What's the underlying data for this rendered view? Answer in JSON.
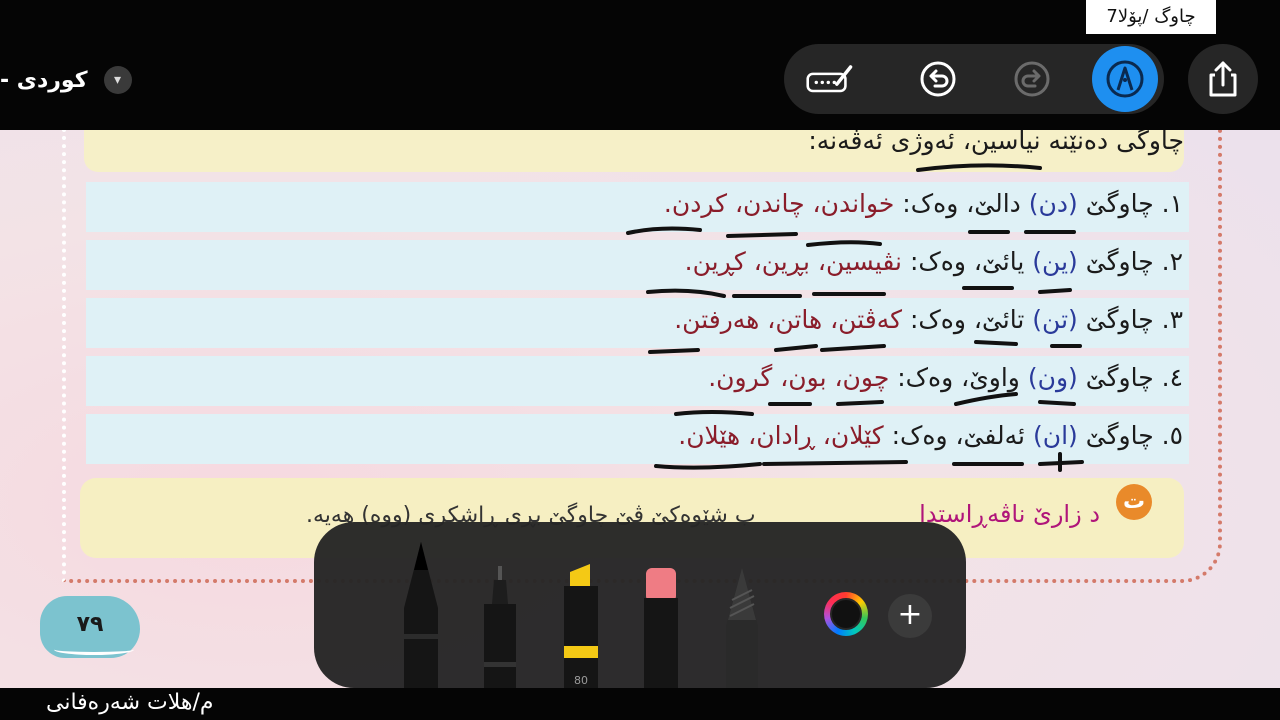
{
  "window": {
    "title": "چاوگ /پۆلا7"
  },
  "language": {
    "label": "کوردی -"
  },
  "toolbar": {
    "markup_icon": "markup-icon",
    "undo_icon": "undo-icon",
    "redo_icon": "redo-icon",
    "pen_icon": "pen-active-icon",
    "share_icon": "share-icon"
  },
  "content": {
    "intro": "چاوگی دەنێنە نیاسین، ئەوژی ئەڤەنە:",
    "rules": [
      {
        "number": "١.",
        "prefix": "چاوگێ",
        "suffix": "دن",
        "letter": "دالێ، وەک:",
        "examples": "خواندن، چاندن، کردن."
      },
      {
        "number": "٢.",
        "prefix": "چاوگێ",
        "suffix": "ین",
        "letter": "یائێ، وەک:",
        "examples": "نڤیسین، بڕین، کڕین."
      },
      {
        "number": "٣.",
        "prefix": "چاوگێ",
        "suffix": "تن",
        "letter": "تائێ، وەک:",
        "examples": "کەڤتن، هاتن، هەرفتن."
      },
      {
        "number": "٤.",
        "prefix": "چاوگێ",
        "suffix": "ون",
        "letter": "واوێ، وەک:",
        "examples": "چون، بون، گرون."
      },
      {
        "number": "٥.",
        "prefix": "چاوگێ",
        "suffix": "ان",
        "letter": "ئەلفێ، وەک:",
        "examples": "کێلان، ڕادان، هێلان."
      }
    ],
    "note": {
      "badge": "ت",
      "title": "د زارێ ناڤەڕاستدا",
      "text": "ب شێوەکێ ڤێ چاوگێ بڕی ڕاشکری (ووە) هەیە."
    },
    "page_number": "٧٩"
  },
  "pen_tray": {
    "marker_size": "80",
    "add_label": "+"
  },
  "footer": {
    "author": "م/هلات شەرەفانی"
  },
  "colors": {
    "accent": "#1e8ff0",
    "example_text": "#8a1d2a",
    "paren_text": "#2a3a9a",
    "row_bg": "#dff1f6",
    "note_bg": "#f6efc2",
    "badge": "#e98a2a"
  }
}
